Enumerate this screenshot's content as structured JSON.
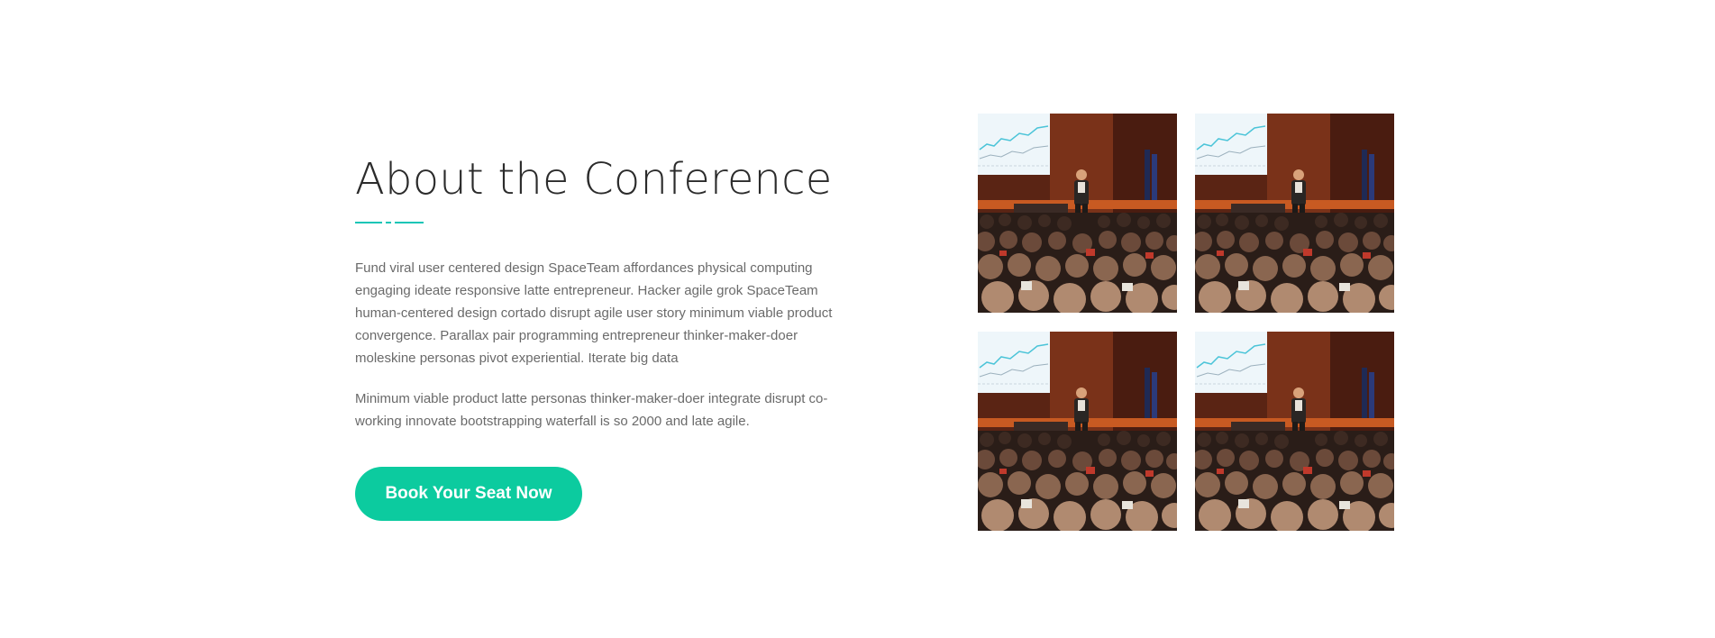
{
  "about": {
    "title": "About the Conference",
    "paragraph_1": "Fund viral user centered design SpaceTeam affordances physical computing engaging ideate responsive latte entrepreneur. Hacker agile grok SpaceTeam human-centered design cortado disrupt agile user story minimum viable product convergence. Parallax pair programming entrepreneur thinker-maker-doer moleskine personas pivot experiential. Iterate big data",
    "paragraph_2": "Minimum viable product latte personas thinker-maker-doer integrate disrupt co-working innovate bootstrapping waterfall is so 2000 and late agile.",
    "cta_label": "Book Your Seat Now"
  },
  "gallery": {
    "photos": [
      {
        "subject": "conference-audience-photo"
      },
      {
        "subject": "conference-audience-photo"
      },
      {
        "subject": "conference-audience-photo"
      },
      {
        "subject": "conference-audience-photo"
      }
    ]
  },
  "colors": {
    "accent": "#0ccb9f",
    "divider": "#14c5b6",
    "heading": "#2b2b2b",
    "body_text": "#6a6a6a"
  }
}
